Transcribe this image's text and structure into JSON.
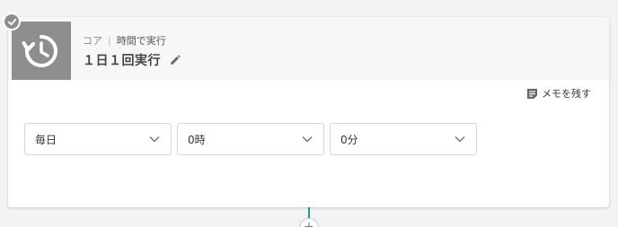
{
  "header": {
    "category": "コア",
    "trigger_type": "時間で実行",
    "title": "１日１回実行",
    "icon": "clock-rotate-icon"
  },
  "memo": {
    "label": "メモを残す",
    "icon": "note-icon"
  },
  "schedule": {
    "frequency": "毎日",
    "hour": "0時",
    "minute": "0分"
  },
  "add_node": {
    "symbol": "+"
  },
  "colors": {
    "icon_bg": "#8e8e8e",
    "connector": "#2a8ea6",
    "header_bg": "#f7f7f7"
  }
}
